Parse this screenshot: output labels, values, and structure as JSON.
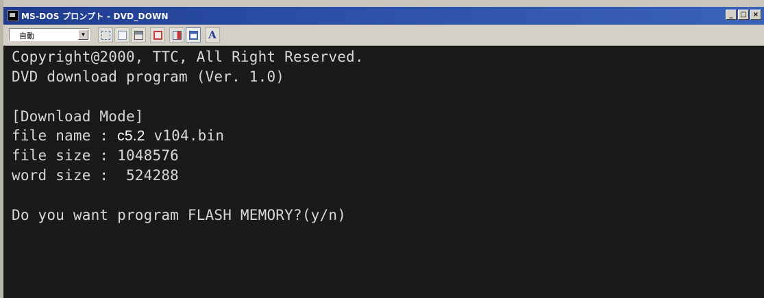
{
  "window": {
    "title": "MS-DOS プロンプト - DVD_DOWN",
    "controls": [
      "_",
      "□",
      "×"
    ]
  },
  "toolbar": {
    "font_select_value": "自動",
    "tool_icons": [
      "mark-icon",
      "copy-icon",
      "paste-icon",
      "fullscreen-icon",
      "properties-icon",
      "background-icon",
      "font-icon"
    ],
    "font_button_label": "A"
  },
  "console": {
    "lines": [
      "Copyright@2000, TTC, All Right Reserved.",
      "DVD download program (Ver. 1.0)",
      "",
      "[Download Mode]",
      "file name : ",
      "file size : 1048576",
      "word size :  524288",
      "",
      "Do you want program FLASH MEMORY?(y/n)"
    ],
    "file_name_label": "c5.2",
    "file_name_suffix": " v104.bin"
  }
}
